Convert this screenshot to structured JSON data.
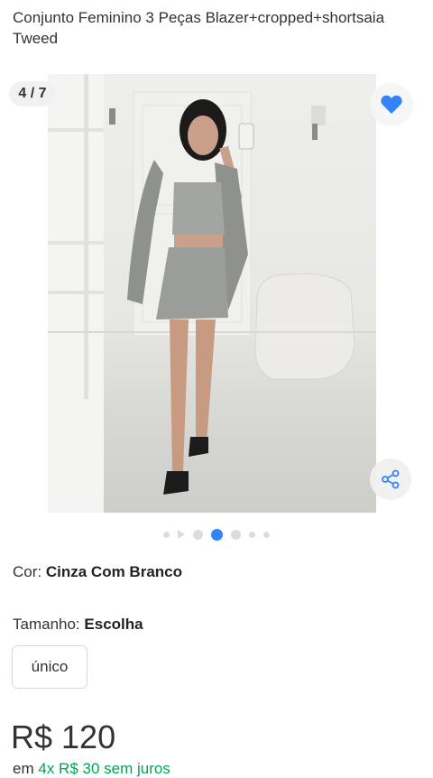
{
  "product": {
    "title": "Conjunto Feminino 3 Peças Blazer+cropped+shortsaia Tweed"
  },
  "gallery": {
    "counter": "4 / 7",
    "current_index": 4,
    "total": 7,
    "favorite_icon": "heart-icon",
    "favorite_color": "#3483fa",
    "share_icon": "share-icon"
  },
  "color_attr": {
    "label": "Cor:",
    "value": "Cinza Com Branco"
  },
  "size_attr": {
    "label": "Tamanho:",
    "value": "Escolha",
    "option": "único"
  },
  "price": {
    "value": "R$ 120"
  },
  "installments": {
    "prefix": "em",
    "text": "4x R$ 30 sem juros",
    "color": "#00a650"
  },
  "colors": {
    "accent": "#3483fa",
    "text": "#333333"
  }
}
